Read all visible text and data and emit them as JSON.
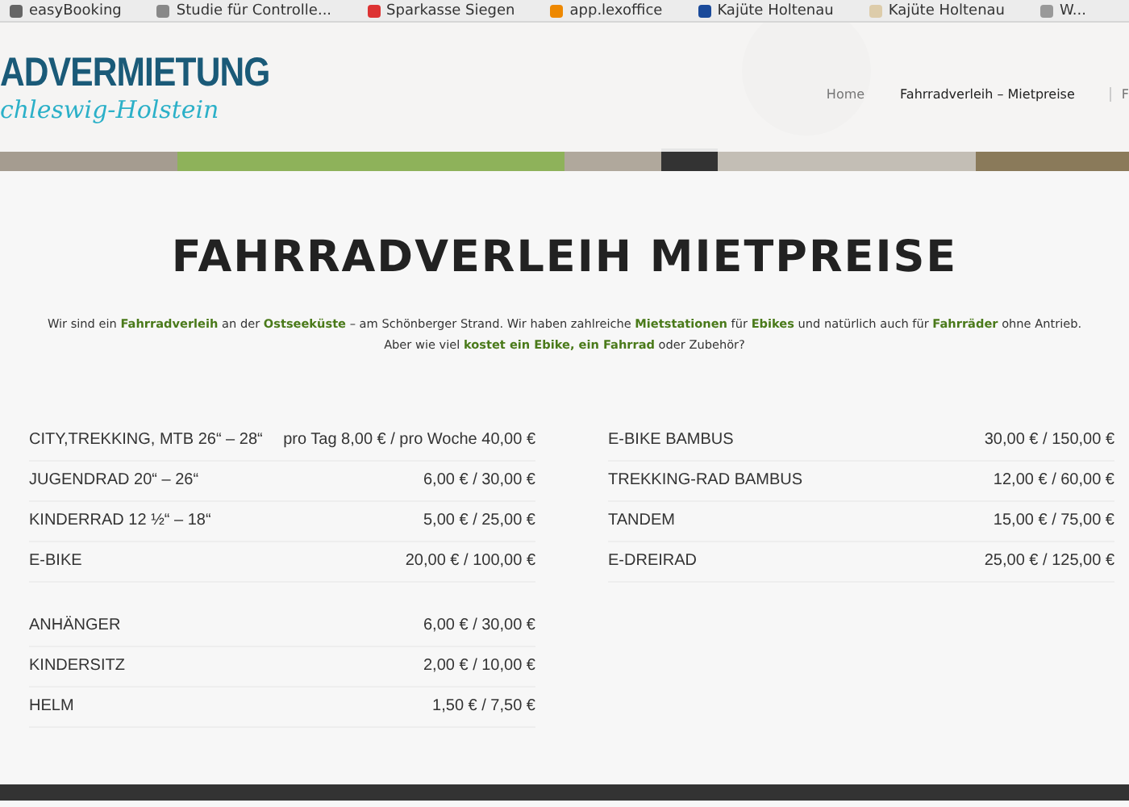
{
  "bookmarks": [
    {
      "label": "easyBooking"
    },
    {
      "label": "Studie für Controlle..."
    },
    {
      "label": "Sparkasse Siegen"
    },
    {
      "label": "app.lexoffice"
    },
    {
      "label": "Kajüte Holtenau"
    },
    {
      "label": "Kajüte Holtenau"
    },
    {
      "label": "W..."
    }
  ],
  "logo": {
    "title": "ADVERMIETUNG",
    "subtitle": "chleswig-Holstein"
  },
  "nav": [
    {
      "label": "Home",
      "selected": false
    },
    {
      "label": "Fahrradverleih – Mietpreise",
      "selected": true
    },
    {
      "label": "F",
      "selected": false
    }
  ],
  "heading": "FAHRRADVERLEIH MIETPREISE",
  "intro": "Wir sind ein **Fahrradverleih** an der **Ostseeküste** – am Schönberger Strand. Wir haben zahlreiche **Mietstationen** für **Ebikes** und natürlich auch für **Fahrräder** ohne Antrieb. Aber wie viel **kostet ein Ebike, ein Fahrrad** oder Zubehör?",
  "price_columns": [
    [
      [
        {
          "item": "CITY,TREKKING, MTB 26“ – 28“",
          "price": "pro Tag 8,00 € / pro Woche 40,00 €"
        },
        {
          "item": "JUGENDRAD 20“ – 26“",
          "price": "6,00 € / 30,00 €"
        },
        {
          "item": "KINDERRAD 12 ½“ – 18“",
          "price": "5,00 € / 25,00 €"
        },
        {
          "item": "E-BIKE",
          "price": "20,00 € / 100,00 €"
        }
      ],
      [
        {
          "item": "ANHÄNGER",
          "price": "6,00 € / 30,00 €"
        },
        {
          "item": "KINDERSITZ",
          "price": "2,00 € / 10,00 €"
        },
        {
          "item": "HELM",
          "price": "1,50 € / 7,50 €"
        }
      ]
    ],
    [
      [
        {
          "item": "E-BIKE BAMBUS",
          "price": "30,00 € / 150,00 €"
        },
        {
          "item": "TREKKING-RAD BAMBUS",
          "price": "12,00 € / 60,00 €"
        },
        {
          "item": "TANDEM",
          "price": "15,00 € / 75,00 €"
        },
        {
          "item": "E-DREIRAD",
          "price": "25,00 € / 125,00 €"
        }
      ]
    ]
  ]
}
